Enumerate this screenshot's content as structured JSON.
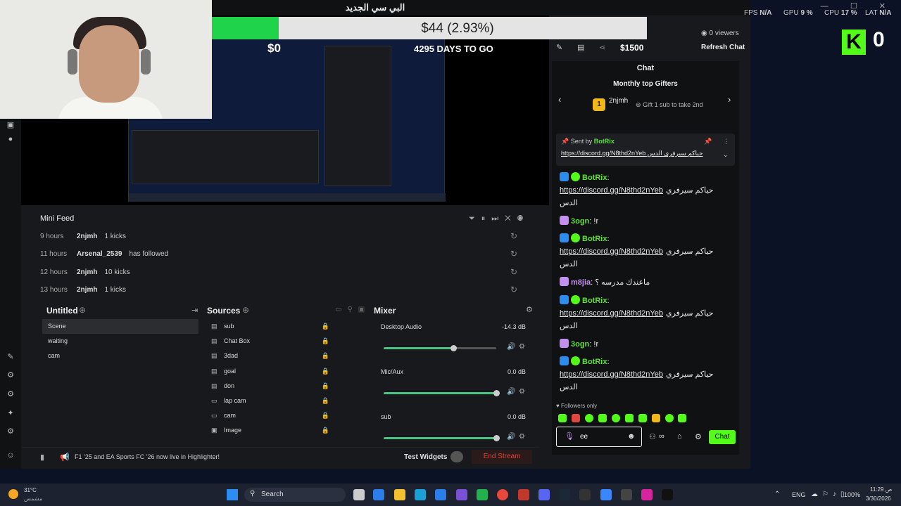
{
  "window": {
    "title": "البي سي الجديد"
  },
  "overlay": {
    "donation_text": "$44 (2.93%)",
    "goal_left": "$0",
    "goal_days": "4295 DAYS TO GO",
    "goal_target": "$1500"
  },
  "stats": {
    "fps_label": "FPS",
    "fps_value": "N/A",
    "gpu_label": "GPU",
    "gpu_value": "9 %",
    "cpu_label": "CPU",
    "cpu_value": "17 %",
    "lat_label": "LAT",
    "lat_value": "N/A",
    "kick_count": "0"
  },
  "viewers": {
    "count": "0 viewers",
    "refresh_label": "Refresh Chat"
  },
  "mini_feed": {
    "title": "Mini Feed",
    "rows": [
      {
        "time": "9 hours",
        "name": "2njmh",
        "action": "1 kicks"
      },
      {
        "time": "11 hours",
        "name": "Arsenal_2539",
        "action": "has followed"
      },
      {
        "time": "12 hours",
        "name": "2njmh",
        "action": "10 kicks"
      },
      {
        "time": "13 hours",
        "name": "2njmh",
        "action": "1 kicks"
      }
    ]
  },
  "scenes": {
    "title": "Untitled",
    "items": [
      "Scene",
      "waiting",
      "cam"
    ]
  },
  "sources": {
    "title": "Sources",
    "items": [
      "sub",
      "Chat Box",
      "3dad",
      "goal",
      "don",
      "lap cam",
      "cam",
      "Image"
    ]
  },
  "mixer": {
    "title": "Mixer",
    "channels": [
      {
        "name": "Desktop Audio",
        "db": "-14.3 dB",
        "level": 0.62
      },
      {
        "name": "Mic/Aux",
        "db": "0.0 dB",
        "level": 1.0
      },
      {
        "name": "sub",
        "db": "0.0 dB",
        "level": 1.0
      }
    ]
  },
  "bottom": {
    "promo": "F1 '25 and EA Sports FC '26 now live in Highlighter!",
    "test_widgets": "Test Widgets",
    "end_stream": "End Stream"
  },
  "chat": {
    "title": "Chat",
    "top_gifters_title": "Monthly top Gifters",
    "gifter_rank": "1",
    "gifter_name": "2njmh",
    "gift_hint": "Gift 1 sub to take 2nd",
    "pinned_sent_by": "Sent by",
    "pinned_user": "BotRix",
    "pinned_text": "https://discord.gg/N8thd2nYeb حياكم سيرفري الدس",
    "messages": [
      {
        "user": "BotRix",
        "color": "#5fe03e",
        "link": "https://discord.gg/N8thd2nYeb",
        "text": "حياكم سيرفري",
        "tail": "الدس"
      },
      {
        "user": "3ogn",
        "color": "#5fe03e",
        "link": "",
        "text": "!r",
        "tail": ""
      },
      {
        "user": "BotRix",
        "color": "#5fe03e",
        "link": "https://discord.gg/N8thd2nYeb",
        "text": "حياكم سيرفري",
        "tail": "الدس"
      },
      {
        "user": "m8jia",
        "color": "#c490f0",
        "link": "",
        "text": "ماعندك مدرسه ؟",
        "tail": ""
      },
      {
        "user": "BotRix",
        "color": "#5fe03e",
        "link": "https://discord.gg/N8thd2nYeb",
        "text": "حياكم سيرفري",
        "tail": "الدس"
      },
      {
        "user": "3ogn",
        "color": "#5fe03e",
        "link": "",
        "text": "!r",
        "tail": ""
      },
      {
        "user": "BotRix",
        "color": "#5fe03e",
        "link": "https://discord.gg/N8thd2nYeb",
        "text": "حياكم سيرفري",
        "tail": "الدس"
      }
    ],
    "followers_only": "Followers only",
    "input_value": "ee",
    "send_label": "Chat"
  },
  "taskbar": {
    "weather_temp": "31°C",
    "weather_desc": "مشمس",
    "search_label": "Search",
    "lang": "ENG",
    "battery": "100%",
    "time": "11:29 ص",
    "date": "3/30/2026"
  },
  "colors": {
    "accent": "#53fc18",
    "chat_bg": "#101113",
    "end_stream": "#e0473e"
  }
}
